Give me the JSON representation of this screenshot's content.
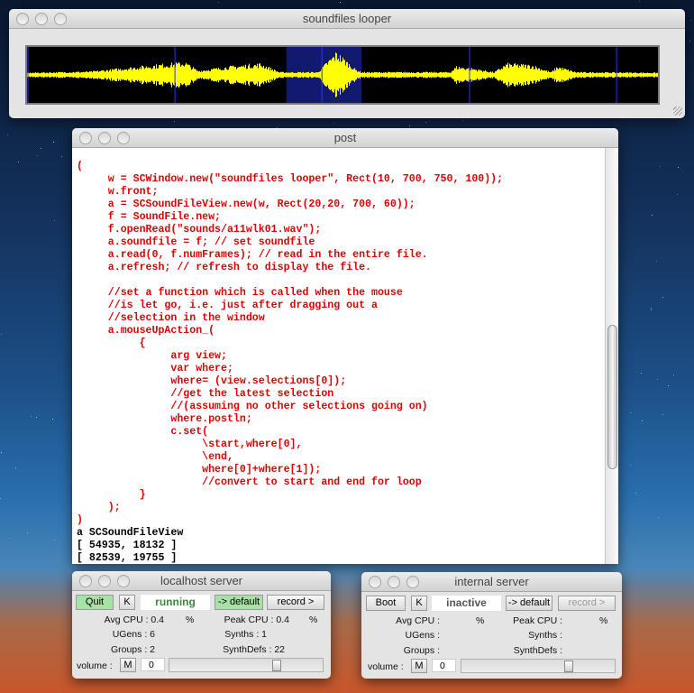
{
  "looper": {
    "title": "soundfiles looper",
    "selection": {
      "start_fraction": 0.411,
      "end_fraction": 0.53
    },
    "colors": {
      "waveform": "#ffff00",
      "background": "#000000",
      "selection": "#121a70",
      "grid": "#3030ff"
    }
  },
  "post": {
    "title": "post",
    "lines": [
      {
        "text": "(",
        "color": "#e00000"
      },
      {
        "text": "     w = SCWindow.new(\"soundfiles looper\", Rect(10, 700, 750, 100));",
        "color": "#e00000"
      },
      {
        "text": "     w.front;",
        "color": "#e00000"
      },
      {
        "text": "     a = SCSoundFileView.new(w, Rect(20,20, 700, 60));",
        "color": "#e00000"
      },
      {
        "text": "     f = SoundFile.new;",
        "color": "#e00000"
      },
      {
        "text": "     f.openRead(\"sounds/a11wlk01.wav\");",
        "color": "#e00000"
      },
      {
        "text": "     a.soundfile = f; // set soundfile",
        "color": "#e00000"
      },
      {
        "text": "     a.read(0, f.numFrames); // read in the entire file.",
        "color": "#e00000"
      },
      {
        "text": "     a.refresh; // refresh to display the file.",
        "color": "#e00000"
      },
      {
        "text": "",
        "color": "#e00000"
      },
      {
        "text": "     //set a function which is called when the mouse",
        "color": "#e00000"
      },
      {
        "text": "     //is let go, i.e. just after dragging out a",
        "color": "#e00000"
      },
      {
        "text": "     //selection in the window",
        "color": "#e00000"
      },
      {
        "text": "     a.mouseUpAction_(",
        "color": "#e00000"
      },
      {
        "text": "          {",
        "color": "#e00000"
      },
      {
        "text": "               arg view;",
        "color": "#e00000"
      },
      {
        "text": "               var where;",
        "color": "#e00000"
      },
      {
        "text": "               where= (view.selections[0]);",
        "color": "#e00000"
      },
      {
        "text": "               //get the latest selection",
        "color": "#e00000"
      },
      {
        "text": "               //(assuming no other selections going on)",
        "color": "#e00000"
      },
      {
        "text": "               where.postln;",
        "color": "#e00000"
      },
      {
        "text": "               c.set(",
        "color": "#e00000"
      },
      {
        "text": "                    \\start,where[0],",
        "color": "#e00000"
      },
      {
        "text": "                    \\end,",
        "color": "#e00000"
      },
      {
        "text": "                    where[0]+where[1]);",
        "color": "#e00000"
      },
      {
        "text": "                    //convert to start and end for loop",
        "color": "#e00000"
      },
      {
        "text": "          }",
        "color": "#e00000"
      },
      {
        "text": "     );",
        "color": "#e00000"
      },
      {
        "text": ")",
        "color": "#e00000"
      },
      {
        "text": "a SCSoundFileView",
        "color": "#000000"
      },
      {
        "text": "[ 54935, 18132 ]",
        "color": "#000000"
      },
      {
        "text": "[ 82539, 19755 ]",
        "color": "#000000"
      }
    ]
  },
  "localhost": {
    "title": "localhost server",
    "quit": "Quit",
    "k": "K",
    "status": "running",
    "default": "-> default",
    "record": "record >",
    "avg_cpu": "Avg CPU : 0.4",
    "avg_pct": "%",
    "peak_cpu": "Peak CPU : 0.4",
    "peak_pct": "%",
    "ugens": "UGens : 6",
    "synths": "Synths : 1",
    "groups": "Groups : 2",
    "synthdefs": "SynthDefs : 22",
    "volume_label": "volume :",
    "mute": "M",
    "volume_value": "0",
    "volume_fraction": 0.72,
    "status_color": "#3a8a3a"
  },
  "internal": {
    "title": "internal server",
    "boot": "Boot",
    "k": "K",
    "status": "inactive",
    "default": "-> default",
    "record": "record >",
    "avg_cpu": "Avg CPU :",
    "avg_pct": "%",
    "peak_cpu": "Peak CPU :",
    "peak_pct": "%",
    "ugens": "UGens :",
    "synths": "Synths :",
    "groups": "Groups :",
    "synthdefs": "SynthDefs :",
    "volume_label": "volume :",
    "mute": "M",
    "volume_value": "0",
    "volume_fraction": 0.72,
    "status_color": "#555555"
  }
}
